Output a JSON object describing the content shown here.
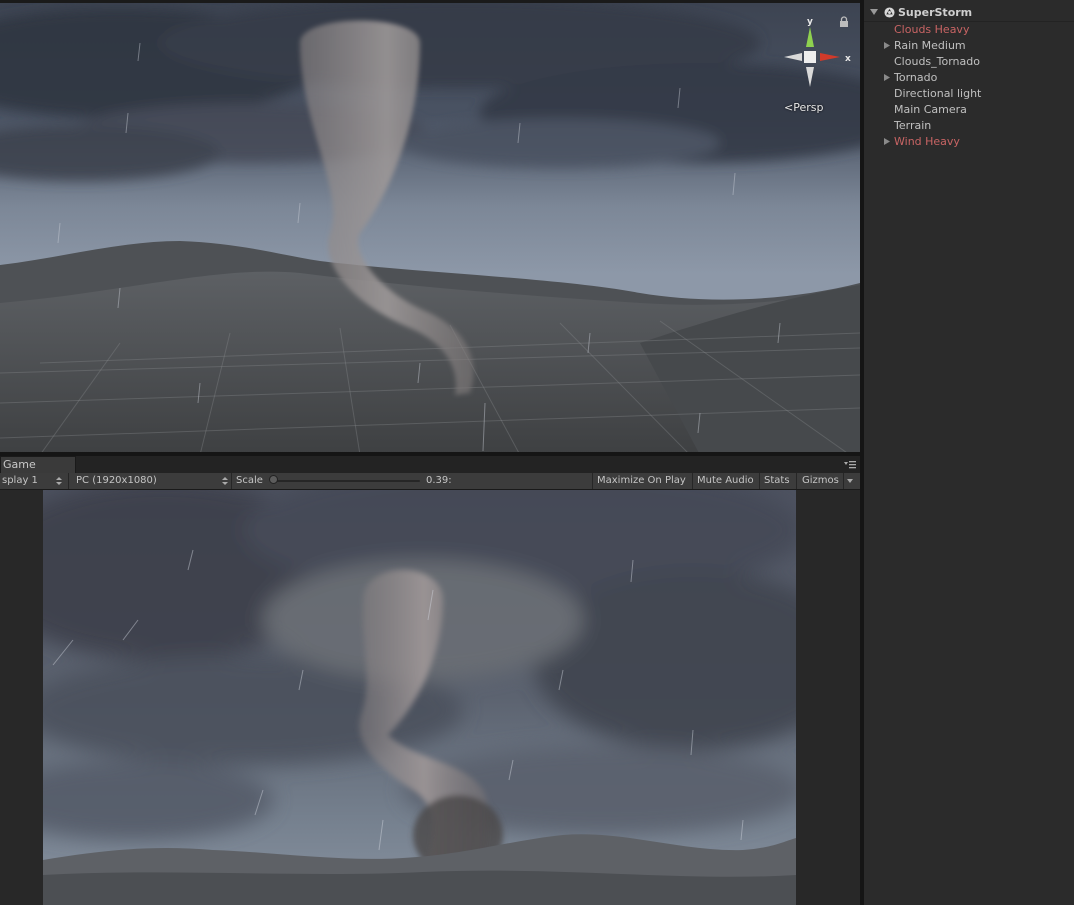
{
  "scene": {
    "persp_label": "Persp",
    "gizmo_axes": {
      "y": "y",
      "x": "x"
    }
  },
  "game_tab": {
    "label": "Game"
  },
  "game_toolbar": {
    "display": "splay 1",
    "resolution": "PC (1920x1080)",
    "scale_label": "Scale",
    "scale_value": "0.39:",
    "scale_level": 0.0,
    "maximize_on_play": "Maximize On Play",
    "mute_audio": "Mute Audio",
    "stats": "Stats",
    "gizmos": "Gizmos"
  },
  "hierarchy": {
    "scene_name": "SuperStorm",
    "items": [
      {
        "label": "Clouds Heavy",
        "color": "#c86464",
        "expandable": false
      },
      {
        "label": "Rain Medium",
        "color": "#c0c0c0",
        "expandable": true
      },
      {
        "label": "Clouds_Tornado",
        "color": "#c0c0c0",
        "expandable": false
      },
      {
        "label": "Tornado",
        "color": "#c0c0c0",
        "expandable": true
      },
      {
        "label": "Directional light",
        "color": "#c0c0c0",
        "expandable": false
      },
      {
        "label": "Main Camera",
        "color": "#c0c0c0",
        "expandable": false
      },
      {
        "label": "Terrain",
        "color": "#c0c0c0",
        "expandable": false
      },
      {
        "label": "Wind Heavy",
        "color": "#c86464",
        "expandable": true
      }
    ]
  },
  "icons": {
    "lock": "lock-icon",
    "tab_menu": "menu-icon",
    "unity_scene": "unity-logo-icon",
    "expand": "triangle-right-icon",
    "collapse": "triangle-down-icon",
    "dropdown": "updown-arrow-icon"
  }
}
